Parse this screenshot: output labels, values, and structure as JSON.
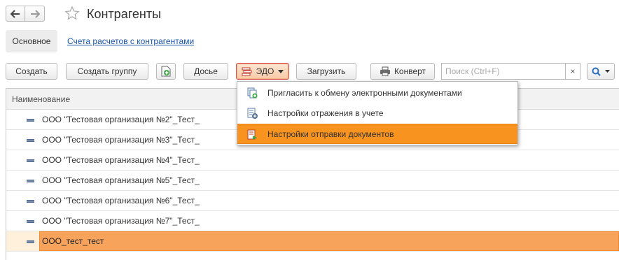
{
  "header": {
    "title": "Контрагенты"
  },
  "tabs": {
    "main": "Основное",
    "accounts": "Счета расчетов с контрагентами"
  },
  "toolbar": {
    "create": "Создать",
    "create_group": "Создать группу",
    "dossier": "Досье",
    "edo": "ЭДО",
    "load": "Загрузить",
    "envelope": "Конверт",
    "search_placeholder": "Поиск (Ctrl+F)",
    "clear": "×"
  },
  "grid": {
    "column": "Наименование",
    "rows": [
      "ООО \"Тестовая организация №2\"_Тест_",
      "ООО \"Тестовая организация №3\"_Тест_",
      "ООО \"Тестовая организация №4\"_Тест_",
      "ООО \"Тестовая организация №5\"_Тест_",
      "ООО \"Тестовая организация №6\"_Тест_",
      "ООО \"Тестовая организация №7\"_Тест_",
      "ООО_тест_тест"
    ]
  },
  "edo_menu": {
    "invite": "Пригласить к обмену электронными документами",
    "reflect": "Настройки отражения в учете",
    "send": "Настройки отправки документов"
  },
  "colors": {
    "accent": "#f7931e",
    "selection": "#f7a35c",
    "link": "#1a55a8"
  },
  "icons": {
    "back": "arrow-left-icon",
    "forward": "arrow-right-icon",
    "star": "star-icon",
    "copy": "add-document-icon",
    "edo": "edo-icon",
    "envelope": "printer-icon",
    "search": "search-icon",
    "invite": "invite-icon",
    "reflect": "settings-icon",
    "send": "send-settings-icon"
  }
}
